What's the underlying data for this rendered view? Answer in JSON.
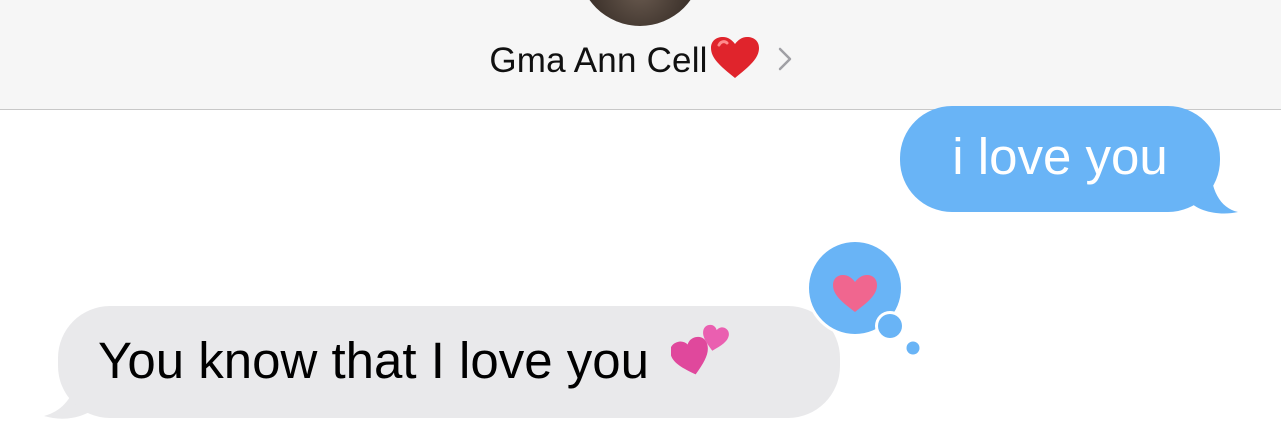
{
  "header": {
    "contact_name": "Gma Ann Cell",
    "name_emoji": "red-heart",
    "chevron_icon": "chevron-right-icon",
    "background": "#f6f6f6"
  },
  "messages": [
    {
      "direction": "sent",
      "text": "i love you",
      "color": "#69b4f6"
    },
    {
      "direction": "received",
      "text": "You know that I love you",
      "emoji": "two-hearts",
      "color": "#e9e9eb"
    }
  ],
  "tapback": {
    "reaction": "heart",
    "bubble_color": "#69b4f6",
    "heart_color": "#f0668f"
  }
}
